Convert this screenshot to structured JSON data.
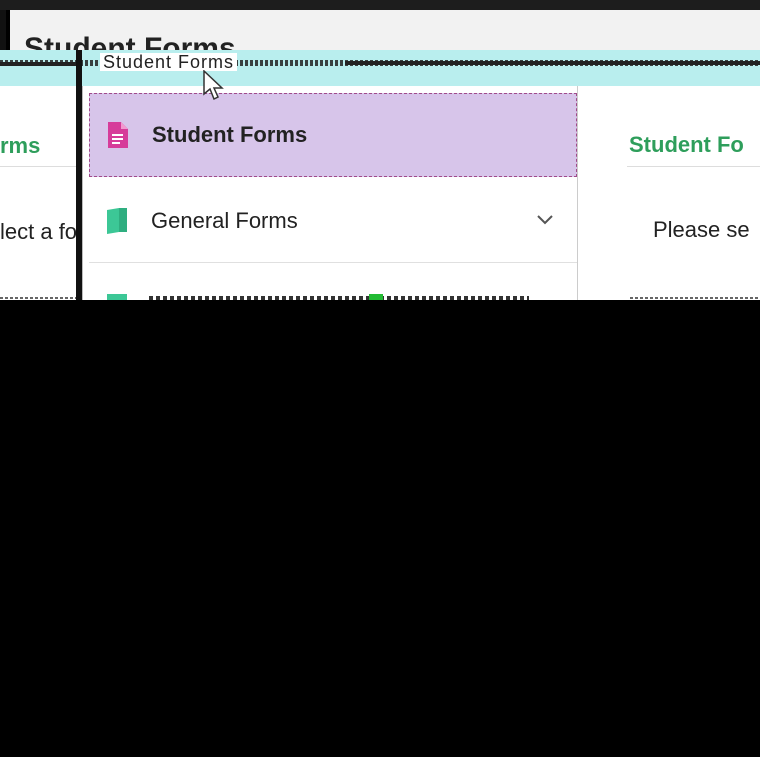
{
  "background_window": {
    "header_title": "Student Forms",
    "header_mini": "• • • •",
    "glitch_title": "Student Forms",
    "left_heading": "rms",
    "left_text": "lect a fo",
    "right_heading": "Student Fo",
    "right_text": "Please se"
  },
  "dropdown": {
    "items": [
      {
        "label": "Student Forms",
        "icon": "document-icon",
        "icon_color": "#d63c9a",
        "selected": true
      },
      {
        "label": "General Forms",
        "icon": "folder-icon",
        "icon_color": "#3cc796",
        "expandable": true
      }
    ]
  },
  "colors": {
    "accent_green": "#2e9e5b",
    "selected_bg": "#d7c5ea",
    "glitch_cyan": "#b9eeee"
  }
}
